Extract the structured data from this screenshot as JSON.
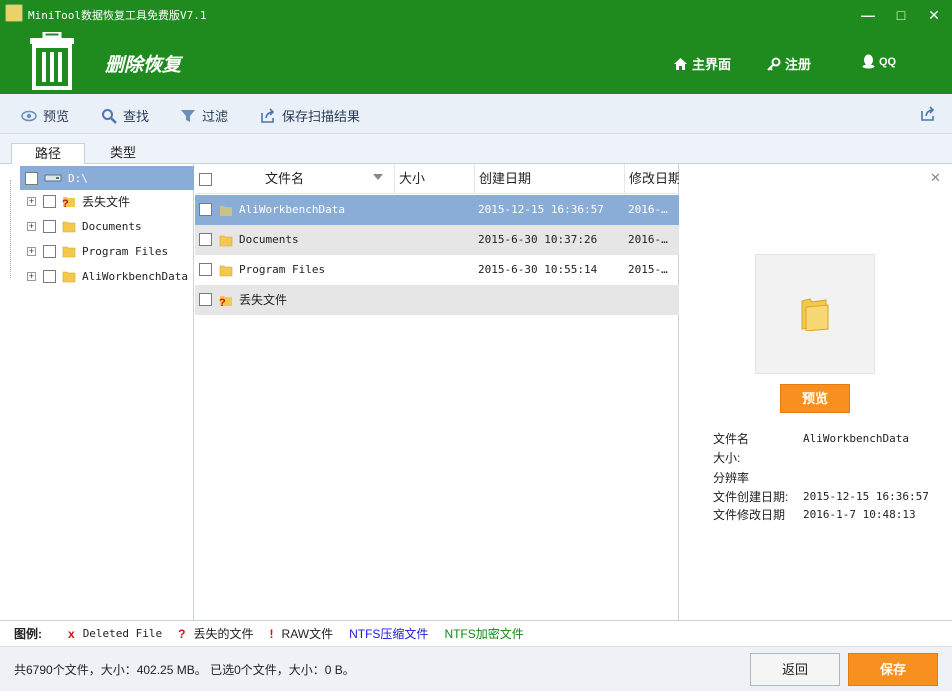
{
  "window": {
    "title": "MiniTool数据恢复工具免费版V7.1",
    "min_glyph": "—",
    "max_glyph": "□",
    "close_glyph": "✕"
  },
  "header": {
    "page_title": "删除恢复",
    "nav": [
      {
        "label": "主界面",
        "icon": "home-icon"
      },
      {
        "label": "注册",
        "icon": "key-icon"
      },
      {
        "label": "QQ",
        "icon": "qq-penguin-icon"
      }
    ]
  },
  "toolbar": {
    "preview": "预览",
    "search": "查找",
    "filter": "过滤",
    "save_scan": "保存扫描结果"
  },
  "tabs": {
    "path": "路径",
    "type": "类型"
  },
  "tree": {
    "root": "D:\\",
    "items": [
      {
        "label": "丢失文件",
        "icon": "lost-folder-icon"
      },
      {
        "label": "Documents",
        "icon": "folder-icon"
      },
      {
        "label": "Program Files",
        "icon": "folder-icon"
      },
      {
        "label": "AliWorkbenchData",
        "icon": "folder-icon"
      }
    ]
  },
  "filelist": {
    "columns": {
      "name": "文件名",
      "size": "大小",
      "created": "创建日期",
      "modified": "修改日期"
    },
    "rows": [
      {
        "name": "AliWorkbenchData",
        "size": "",
        "created": "2015-12-15 16:36:57",
        "modified": "2016-…"
      },
      {
        "name": "Documents",
        "size": "",
        "created": "2015-6-30 10:37:26",
        "modified": "2016-…"
      },
      {
        "name": "Program Files",
        "size": "",
        "created": "2015-6-30 10:55:14",
        "modified": "2015-…"
      },
      {
        "name": "丢失文件",
        "size": "",
        "created": "",
        "modified": ""
      }
    ]
  },
  "preview": {
    "button": "预览",
    "close_glyph": "✕",
    "info": {
      "name_label": "文件名",
      "name_value": "AliWorkbenchData",
      "size_label": "大小:",
      "size_value": "",
      "resolution_label": "分辨率",
      "resolution_value": "",
      "created_label": "文件创建日期:",
      "created_value": "2015-12-15 16:36:57",
      "modified_label": "文件修改日期",
      "modified_value": "2016-1-7 10:48:13"
    }
  },
  "legend": {
    "title": "图例:",
    "deleted_mark": "x",
    "deleted": "Deleted File",
    "lost_mark": "?",
    "lost": "丢失的文件",
    "raw_mark": "!",
    "raw": "RAW文件",
    "ntfs_compressed": "NTFS压缩文件",
    "ntfs_encrypted": "NTFS加密文件",
    "colors": {
      "compressed": "#1a1adb",
      "encrypted": "#118a11",
      "mark": "#d01010"
    }
  },
  "status": {
    "text": "共6790个文件，大小：402.25 MB。 已选0个文件，大小：0 B。",
    "back": "返回",
    "save": "保存"
  },
  "colors": {
    "header_green": "#1f8b1f",
    "accent_orange": "#f7901e",
    "selection_blue": "#8aadd8"
  }
}
